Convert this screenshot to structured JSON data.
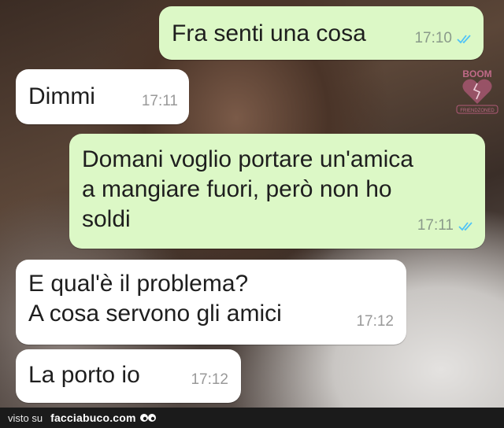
{
  "messages": [
    {
      "direction": "out",
      "lines": "Fra senti una cosa",
      "time": "17:10",
      "ticks": "double-check-icon"
    },
    {
      "direction": "in",
      "lines": "Dimmi",
      "time": "17:11"
    },
    {
      "direction": "out",
      "lines": "Domani voglio portare un'amica\na mangiare fuori, però non ho\nsoldi",
      "time": "17:11",
      "ticks": "double-check-icon"
    },
    {
      "direction": "in",
      "lines": "E qual'è il problema?\nA cosa servono gli amici",
      "time": "17:12"
    },
    {
      "direction": "in",
      "lines": "La porto io",
      "time": "17:12"
    }
  ],
  "watermark": {
    "top_text": "BOOM",
    "bottom_text": "FRIENDZONED",
    "color": "#b05a78"
  },
  "footer": {
    "prefix": "visto su",
    "brand": "facciabuco.com"
  },
  "colors": {
    "outgoing_bubble": "#dcf8c6",
    "incoming_bubble": "#ffffff",
    "tick_blue": "#4fc3f7"
  }
}
